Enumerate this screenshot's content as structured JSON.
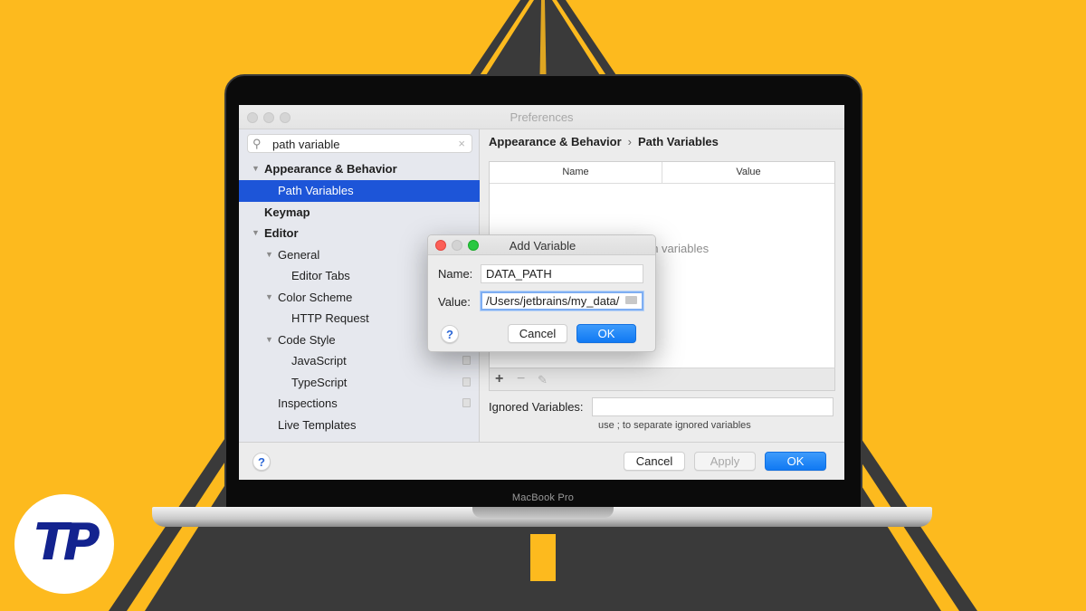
{
  "window": {
    "title": "Preferences"
  },
  "search": {
    "value": "path variable",
    "search_icon": "search-icon",
    "clear_icon": "clear-icon"
  },
  "tree": {
    "items": [
      {
        "label": "Appearance & Behavior",
        "expanded": true
      },
      {
        "label": "Path Variables",
        "selected": true
      },
      {
        "label": "Keymap"
      },
      {
        "label": "Editor",
        "expanded": true
      },
      {
        "label": "General",
        "expanded": true
      },
      {
        "label": "Editor Tabs"
      },
      {
        "label": "Color Scheme",
        "expanded": true
      },
      {
        "label": "HTTP Request"
      },
      {
        "label": "Code Style",
        "expanded": true
      },
      {
        "label": "JavaScript"
      },
      {
        "label": "TypeScript"
      },
      {
        "label": "Inspections"
      },
      {
        "label": "Live Templates"
      }
    ]
  },
  "breadcrumb": {
    "parent": "Appearance & Behavior",
    "separator": "›",
    "current": "Path Variables"
  },
  "table": {
    "columns": [
      "Name",
      "Value"
    ],
    "empty_text": "No path variables",
    "toolbar": {
      "add": "+",
      "remove": "−",
      "edit": "✎"
    }
  },
  "ignored": {
    "label": "Ignored Variables:",
    "value": "",
    "hint": "use ; to separate ignored variables"
  },
  "footer": {
    "help": "?",
    "cancel": "Cancel",
    "apply": "Apply",
    "ok": "OK"
  },
  "dialog": {
    "title": "Add Variable",
    "name_label": "Name:",
    "name_value": "DATA_PATH",
    "value_label": "Value:",
    "value_value": "/Users/jetbrains/my_data/",
    "help": "?",
    "cancel": "Cancel",
    "ok": "OK"
  },
  "device": {
    "label": "MacBook Pro"
  },
  "logo": {
    "text": "TP"
  },
  "colors": {
    "background": "#FDBA1E",
    "road": "#3A3A3A",
    "selection": "#1D55D8",
    "primary_button": "#1079F3",
    "logo": "#13238F"
  }
}
